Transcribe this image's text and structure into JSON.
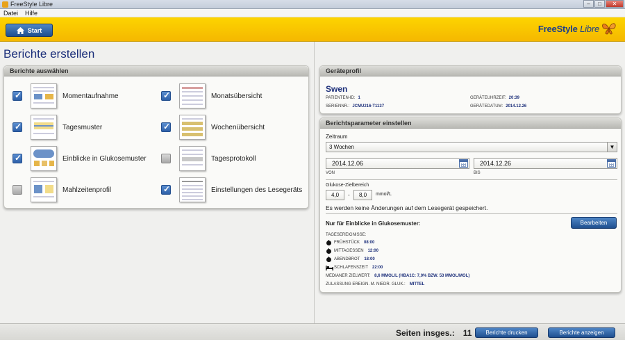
{
  "window": {
    "title": "FreeStyle Libre"
  },
  "menu": {
    "items": [
      "Datei",
      "Hilfe"
    ]
  },
  "header": {
    "start_label": "Start",
    "logo_main": "FreeStyle",
    "logo_accent": "Libre"
  },
  "page": {
    "title": "Berichte erstellen"
  },
  "reports_panel": {
    "title": "Berichte auswählen",
    "items": [
      {
        "label": "Momentaufnahme",
        "checked": true
      },
      {
        "label": "Monatsübersicht",
        "checked": true
      },
      {
        "label": "Tagesmuster",
        "checked": true
      },
      {
        "label": "Wochenübersicht",
        "checked": true
      },
      {
        "label": "Einblicke in Glukosemuster",
        "checked": true
      },
      {
        "label": "Tagesprotokoll",
        "checked": false
      },
      {
        "label": "Mahlzeitenprofil",
        "checked": false
      },
      {
        "label": "Einstellungen des Lesegeräts",
        "checked": true
      }
    ]
  },
  "device_panel": {
    "title": "Geräteprofil",
    "patient_name": "Swen",
    "patient_id_label": "Patienten-ID:",
    "patient_id": "1",
    "serial_label": "Seriennr.:",
    "serial": "JCMU216-T1137",
    "device_time_label": "Geräteuhrzeit:",
    "device_time": "20:39",
    "device_date_label": "Gerätedatum:",
    "device_date": "2014.12.26"
  },
  "params_panel": {
    "title": "Berichtsparameter einstellen",
    "range_label": "Zeitraum",
    "range_value": "3 Wochen",
    "from_date": "2014.12.06",
    "from_label": "VON",
    "to_date": "2014.12.26",
    "to_label": "BIS",
    "target_label": "Glukose-Zielbereich",
    "target_low": "4,0",
    "target_dash": "-",
    "target_high": "8,0",
    "target_unit": "mmol/L",
    "note": "Es werden keine Änderungen auf dem Lesegerät gespeichert.",
    "insights_title": "Nur für Einblicke in Glukosemuster:",
    "edit_label": "Bearbeiten",
    "events_title": "Tagesereignisse:",
    "events": [
      {
        "label": "Frühstück",
        "time": "08:00",
        "icon": "apple-icon"
      },
      {
        "label": "Mittagessen",
        "time": "12:00",
        "icon": "apple-icon"
      },
      {
        "label": "Abendbrot",
        "time": "18:00",
        "icon": "apple-icon"
      },
      {
        "label": "Schlafenszeit",
        "time": "22:00",
        "icon": "bed-icon"
      }
    ],
    "median_label": "Medianer Zielwert:",
    "median_value": "8,6 mmol/L (HbA1c: 7,0% bzw. 53 mmol/mol)",
    "allow_label": "Zulassung ereign. m. niedr. Gluk.:",
    "allow_value": "Mittel"
  },
  "footer": {
    "pages_label": "Seiten insges.:",
    "pages_count": "11",
    "print_label": "Berichte drucken",
    "show_label": "Berichte anzeigen"
  }
}
